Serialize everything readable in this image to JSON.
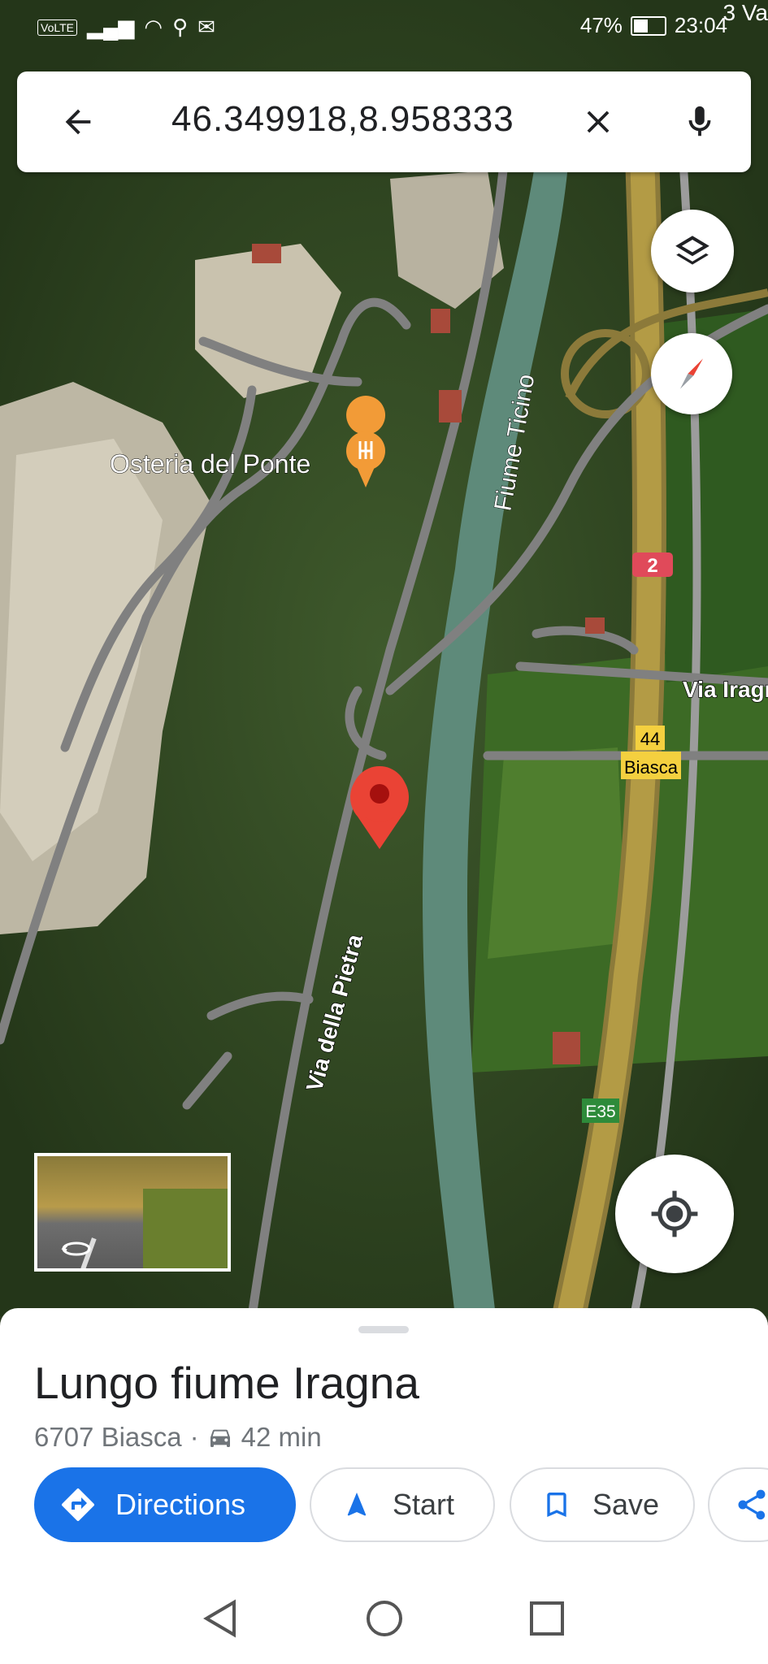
{
  "status_bar": {
    "volte": "VoLTE",
    "battery": "47%",
    "time": "23:04",
    "corner_text": "3 Va"
  },
  "search": {
    "query": "46.349918,8.958333",
    "back_icon": "arrow-back-icon",
    "clear_icon": "close-icon",
    "mic_icon": "mic-icon"
  },
  "map": {
    "poi_label": "Osteria del Ponte",
    "river_label": "Fiume Ticino",
    "road_label_street": "Via della Pietra",
    "road_label_east": "Via Iragn",
    "route_shield": "2",
    "exit_number": "44",
    "exit_name": "Biasca",
    "euro_route": "E35"
  },
  "place": {
    "title": "Lungo fiume Iragna",
    "address": "6707 Biasca",
    "separator": "·",
    "drive_time": "42 min"
  },
  "actions": {
    "directions": "Directions",
    "start": "Start",
    "save": "Save"
  },
  "colors": {
    "accent": "#1a73e8",
    "pin": "#ea4335",
    "poi": "#f29b37"
  }
}
